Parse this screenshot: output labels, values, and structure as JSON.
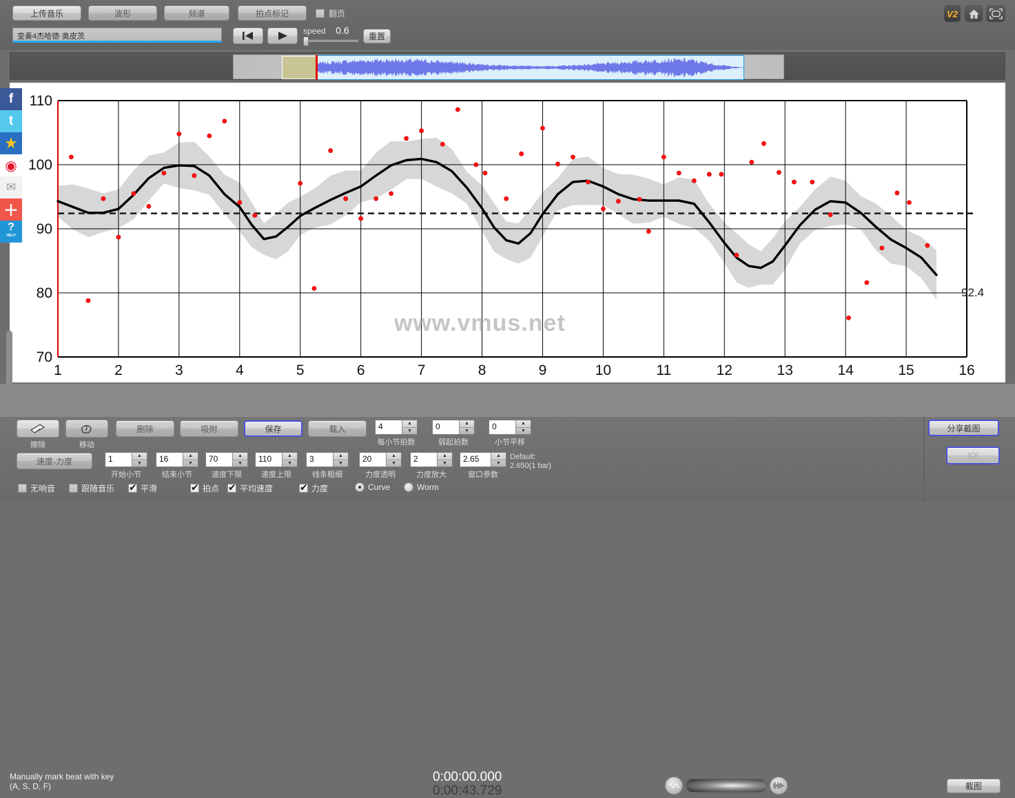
{
  "header": {
    "tabs": [
      {
        "id": "upload",
        "label": "上传音乐",
        "active": true
      },
      {
        "id": "waveform",
        "label": "波形",
        "active": false
      },
      {
        "id": "spectrum",
        "label": "频谱",
        "active": false
      },
      {
        "id": "beatmark",
        "label": "拍点标记",
        "active": false
      }
    ],
    "page_turn_label": "翻页",
    "page_turn_checked": false,
    "track_name": "变奏4杰哈德·奥皮茨",
    "speed_label": "speed",
    "speed_value": "0.6",
    "reset_label": "重置",
    "version_badge": "V2",
    "icons": {
      "rewind": "rewind-icon",
      "play": "play-icon",
      "home": "home-icon",
      "fullscreen": "fullscreen-icon"
    }
  },
  "chart_data": {
    "type": "line",
    "title": "",
    "xlabel": "",
    "ylabel": "",
    "xlim": [
      1,
      16
    ],
    "ylim": [
      70,
      110
    ],
    "xticks": [
      1,
      2,
      3,
      4,
      5,
      6,
      7,
      8,
      9,
      10,
      11,
      12,
      13,
      14,
      15,
      16
    ],
    "yticks": [
      70,
      80,
      90,
      100,
      110
    ],
    "grid": true,
    "watermark": "www.vmus.net",
    "mean_line": {
      "value": 92.4,
      "label": "92.4",
      "style": "dashed"
    },
    "series": [
      {
        "name": "tempo-curve",
        "type": "line",
        "color": "#000000",
        "x": [
          1.0,
          1.25,
          1.5,
          1.75,
          2.0,
          2.25,
          2.5,
          2.75,
          3.0,
          3.25,
          3.5,
          3.75,
          4.0,
          4.2,
          4.4,
          4.6,
          4.8,
          5.0,
          5.25,
          5.5,
          5.75,
          6.0,
          6.25,
          6.5,
          6.75,
          7.0,
          7.25,
          7.5,
          7.75,
          8.0,
          8.2,
          8.4,
          8.6,
          8.8,
          9.0,
          9.25,
          9.5,
          9.75,
          10.0,
          10.25,
          10.5,
          10.75,
          11.0,
          11.25,
          11.5,
          11.75,
          12.0,
          12.2,
          12.4,
          12.6,
          12.8,
          13.0,
          13.25,
          13.5,
          13.75,
          14.0,
          14.25,
          14.5,
          14.75,
          15.0,
          15.25,
          15.5
        ],
        "y": [
          94.3,
          93.4,
          92.5,
          92.5,
          93.1,
          95.3,
          97.9,
          99.5,
          99.9,
          99.8,
          98.3,
          95.4,
          93.4,
          90.6,
          88.4,
          88.8,
          90.3,
          92.0,
          93.3,
          94.5,
          95.6,
          96.6,
          98.3,
          99.9,
          100.7,
          100.9,
          100.4,
          99.0,
          96.4,
          93.2,
          90.2,
          88.2,
          87.7,
          89.3,
          92.3,
          95.4,
          97.3,
          97.5,
          96.6,
          95.4,
          94.6,
          94.4,
          94.4,
          94.4,
          93.9,
          91.0,
          87.8,
          85.5,
          84.2,
          83.9,
          84.9,
          87.4,
          90.6,
          93.0,
          94.3,
          94.1,
          92.5,
          90.3,
          88.3,
          87.0,
          85.5,
          82.8
        ]
      },
      {
        "name": "tempo-observations",
        "type": "scatter",
        "color": "#ff0000",
        "points": [
          [
            1.22,
            101.2
          ],
          [
            1.5,
            78.8
          ],
          [
            1.75,
            94.7
          ],
          [
            2.0,
            88.7
          ],
          [
            2.25,
            95.5
          ],
          [
            2.5,
            93.5
          ],
          [
            2.75,
            98.7
          ],
          [
            3.0,
            104.8
          ],
          [
            3.25,
            98.3
          ],
          [
            3.5,
            104.5
          ],
          [
            3.75,
            106.8
          ],
          [
            4.0,
            94.1
          ],
          [
            4.25,
            92.1
          ],
          [
            5.0,
            97.1
          ],
          [
            5.23,
            80.7
          ],
          [
            5.5,
            102.2
          ],
          [
            5.75,
            94.7
          ],
          [
            6.0,
            91.6
          ],
          [
            6.25,
            94.7
          ],
          [
            6.5,
            95.5
          ],
          [
            6.75,
            104.1
          ],
          [
            7.0,
            105.3
          ],
          [
            7.35,
            103.2
          ],
          [
            7.6,
            108.6
          ],
          [
            7.9,
            100.0
          ],
          [
            8.05,
            98.7
          ],
          [
            8.4,
            94.7
          ],
          [
            8.65,
            101.7
          ],
          [
            9.0,
            105.7
          ],
          [
            9.25,
            100.1
          ],
          [
            9.5,
            101.2
          ],
          [
            9.75,
            97.3
          ],
          [
            10.0,
            93.1
          ],
          [
            10.25,
            94.3
          ],
          [
            10.6,
            94.6
          ],
          [
            10.75,
            89.6
          ],
          [
            11.0,
            101.2
          ],
          [
            11.25,
            98.7
          ],
          [
            11.5,
            97.5
          ],
          [
            11.75,
            98.5
          ],
          [
            11.95,
            98.5
          ],
          [
            12.2,
            85.9
          ],
          [
            12.45,
            100.4
          ],
          [
            12.65,
            103.3
          ],
          [
            12.9,
            98.8
          ],
          [
            13.15,
            97.3
          ],
          [
            13.45,
            97.3
          ],
          [
            13.75,
            92.2
          ],
          [
            14.05,
            76.1
          ],
          [
            14.35,
            81.6
          ],
          [
            14.6,
            87.0
          ],
          [
            14.85,
            95.6
          ],
          [
            15.05,
            94.1
          ],
          [
            15.35,
            87.4
          ]
        ]
      },
      {
        "name": "confidence-band",
        "type": "area",
        "color": "#c8c8c8",
        "halfwidth": 3.2
      }
    ]
  },
  "status": {
    "hint_line1": "Manually mark beat with key",
    "hint_line2": "(A, S, D, F)",
    "time_current": "0:00:00.000",
    "time_total": "0:00:43.729",
    "screenshot_label": "截图"
  },
  "toolbar": {
    "icon_buttons": [
      {
        "id": "erase",
        "label": "擦除",
        "icon": "eraser-icon"
      },
      {
        "id": "move",
        "label": "移动",
        "icon": "hand-move-icon"
      }
    ],
    "actions": [
      {
        "id": "delete",
        "label": "删除",
        "selected": false
      },
      {
        "id": "snap",
        "label": "吸附",
        "selected": false
      },
      {
        "id": "save",
        "label": "保存",
        "selected": true
      },
      {
        "id": "load",
        "label": "载入",
        "selected": false
      }
    ],
    "mode_button": "速度-力度",
    "row1_fields": [
      {
        "id": "beats-per-bar",
        "value": "4",
        "caption": "每小节拍数"
      },
      {
        "id": "pickup-beats",
        "value": "0",
        "caption": "弱起拍数"
      },
      {
        "id": "bar-shift",
        "value": "0",
        "caption": "小节平移"
      }
    ],
    "row2_fields": [
      {
        "id": "start-bar",
        "value": "1",
        "caption": "开始小节"
      },
      {
        "id": "end-bar",
        "value": "16",
        "caption": "结束小节"
      },
      {
        "id": "tempo-min",
        "value": "70",
        "caption": "速度下限"
      },
      {
        "id": "tempo-max",
        "value": "110",
        "caption": "速度上限"
      },
      {
        "id": "line-width",
        "value": "3",
        "caption": "线条粗细"
      },
      {
        "id": "dyn-alpha",
        "value": "20",
        "caption": "力度透明"
      },
      {
        "id": "dyn-scale",
        "value": "2",
        "caption": "力度放大"
      },
      {
        "id": "window-param",
        "value": "2.65",
        "caption": "窗口参数"
      }
    ],
    "default_hint_line1": "Default:",
    "default_hint_line2": "2.650(1 bar)",
    "checkboxes": [
      {
        "id": "no-echo",
        "label": "无响音",
        "checked": false
      },
      {
        "id": "follow-music",
        "label": "跟随音乐",
        "checked": false
      },
      {
        "id": "smooth",
        "label": "平滑",
        "checked": true
      },
      {
        "id": "beat",
        "label": "拍点",
        "checked": true
      },
      {
        "id": "avg-tempo",
        "label": "平均速度",
        "checked": true
      },
      {
        "id": "dynamics",
        "label": "力度",
        "checked": true
      }
    ],
    "radios": [
      {
        "id": "curve",
        "label": "Curve",
        "checked": true
      },
      {
        "id": "worm",
        "label": "Worm",
        "checked": false
      }
    ],
    "share_screenshot": "分享截图",
    "ioi_button": "IOI"
  },
  "social": [
    {
      "id": "facebook",
      "glyph": "f",
      "bg": "#3b5998",
      "name": "facebook-icon"
    },
    {
      "id": "twitter",
      "glyph": "t",
      "bg": "#55c8ee",
      "name": "twitter-icon"
    },
    {
      "id": "qzone",
      "glyph": "★",
      "bg": "#2b6fc2",
      "name": "qzone-star-icon"
    },
    {
      "id": "weibo",
      "glyph": "◉",
      "bg": "#ffffff",
      "name": "weibo-icon"
    },
    {
      "id": "email",
      "glyph": "✉",
      "bg": "#f2f2f2",
      "name": "email-icon"
    },
    {
      "id": "more",
      "glyph": "＋",
      "bg": "#f0564a",
      "name": "share-more-icon"
    },
    {
      "id": "help",
      "glyph": "?",
      "bg": "#2196d6",
      "name": "help-icon"
    }
  ]
}
